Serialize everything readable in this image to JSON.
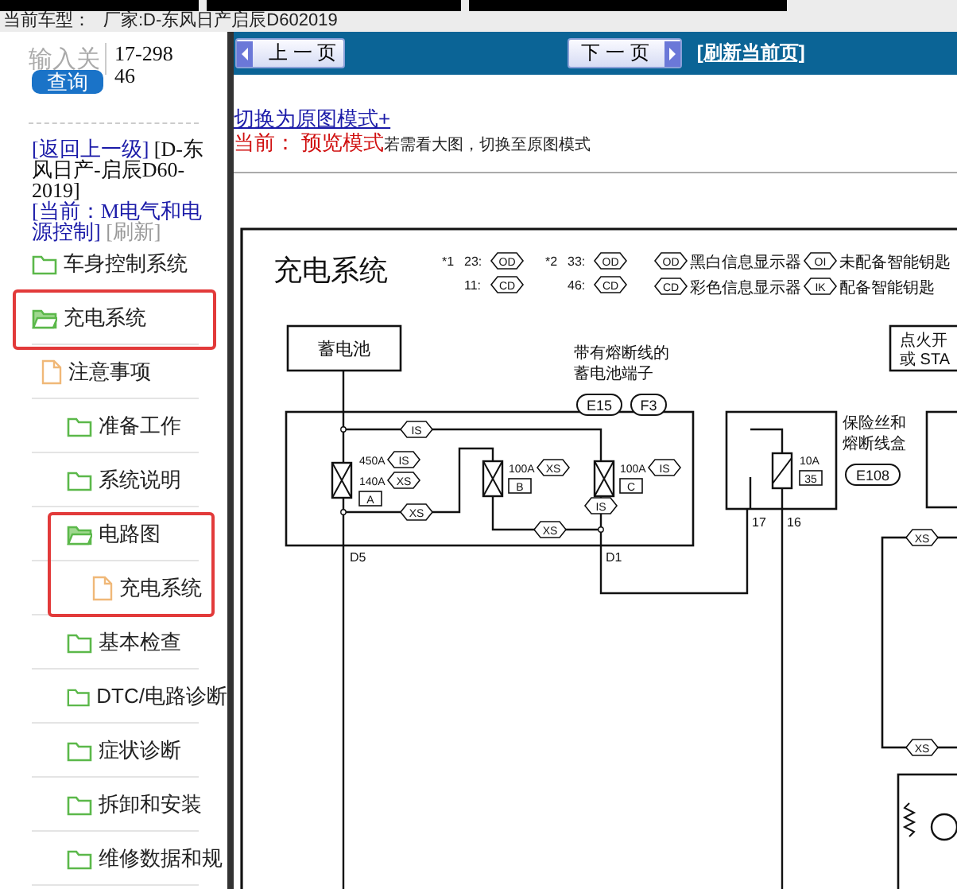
{
  "top_bar": {
    "vehicle_label": "当前车型：",
    "vehicle": "厂家:D-东风日产启辰D602019"
  },
  "search": {
    "placeholder": "输入关",
    "code": "17-29846",
    "button": "查询"
  },
  "breadcrumb": {
    "back": "[返回上一级]",
    "path": "[D-东风日产-启辰D60-2019]",
    "current": "[当前：M电气和电源控制]",
    "refresh": "[刷新]"
  },
  "tree": [
    {
      "label": "车身控制系统",
      "kind": "folder",
      "expanded": false
    },
    {
      "label": "充电系统",
      "kind": "folder",
      "expanded": true,
      "highlighted": true,
      "children": [
        {
          "label": "注意事项",
          "kind": "page",
          "children": [
            {
              "label": "准备工作",
              "kind": "folder",
              "expanded": false
            },
            {
              "label": "系统说明",
              "kind": "folder",
              "expanded": false
            },
            {
              "label": "电路图",
              "kind": "folder",
              "expanded": true,
              "highlighted": true,
              "children": [
                {
                  "label": "充电系统",
                  "kind": "page"
                }
              ]
            },
            {
              "label": "基本检查",
              "kind": "folder",
              "expanded": false
            },
            {
              "label": "DTC/电路诊断",
              "kind": "folder",
              "expanded": false
            },
            {
              "label": "症状诊断",
              "kind": "folder",
              "expanded": false
            },
            {
              "label": "拆卸和安装",
              "kind": "folder",
              "expanded": false
            },
            {
              "label": "维修数据和规",
              "kind": "folder",
              "expanded": false
            }
          ]
        }
      ]
    }
  ],
  "toolbar": {
    "prev": "上 一 页",
    "next": "下 一 页",
    "refresh": "[刷新当前页]"
  },
  "view_mode": {
    "switch_link": "切换为原图模式+",
    "current_label": "当前：",
    "current_mode": "预览模式",
    "hint": "若需看大图，切换至原图模式"
  },
  "diagram": {
    "title": "充电系统",
    "variants": [
      {
        "mark": "*1",
        "entries": [
          {
            "num": "23:",
            "code": "OD"
          },
          {
            "num": "11:",
            "code": "CD"
          }
        ]
      },
      {
        "mark": "*2",
        "entries": [
          {
            "num": "33:",
            "code": "OD"
          },
          {
            "num": "46:",
            "code": "CD"
          }
        ]
      }
    ],
    "legend": [
      {
        "code": "OD",
        "text": "黑白信息显示器"
      },
      {
        "code": "CD",
        "text": "彩色信息显示器"
      },
      {
        "code": "OI",
        "text": "未配备智能钥匙"
      },
      {
        "code": "IK",
        "text": "配备智能钥匙"
      }
    ],
    "blocks": [
      {
        "lines": [
          "蓄电池"
        ]
      },
      {
        "lines": [
          "点火开",
          "或 STA"
        ]
      }
    ],
    "captions": [
      {
        "lines": [
          "带有熔断线的",
          "蓄电池端子"
        ],
        "connectors": [
          "E15",
          "F3"
        ]
      },
      {
        "lines": [
          "保险丝和",
          "熔断线盒"
        ],
        "connectors": [
          "E108"
        ]
      }
    ],
    "fuses": [
      {
        "kind": "link",
        "id": "A",
        "ratings": [
          {
            "value": "450A",
            "tag": "IS"
          },
          {
            "value": "140A",
            "tag": "XS"
          }
        ]
      },
      {
        "kind": "link",
        "id": "B",
        "ratings": [
          {
            "value": "100A",
            "tag": "XS"
          }
        ]
      },
      {
        "kind": "link",
        "id": "C",
        "ratings": [
          {
            "value": "100A",
            "tag": "IS"
          }
        ]
      },
      {
        "kind": "fuse",
        "id": "35",
        "ratings": [
          {
            "value": "10A"
          }
        ]
      }
    ],
    "wire_tags": [
      "IS",
      "XS",
      "IS",
      "XS",
      "XS",
      "XS"
    ],
    "pins": [
      "D5",
      "D1",
      "17",
      "16"
    ]
  }
}
